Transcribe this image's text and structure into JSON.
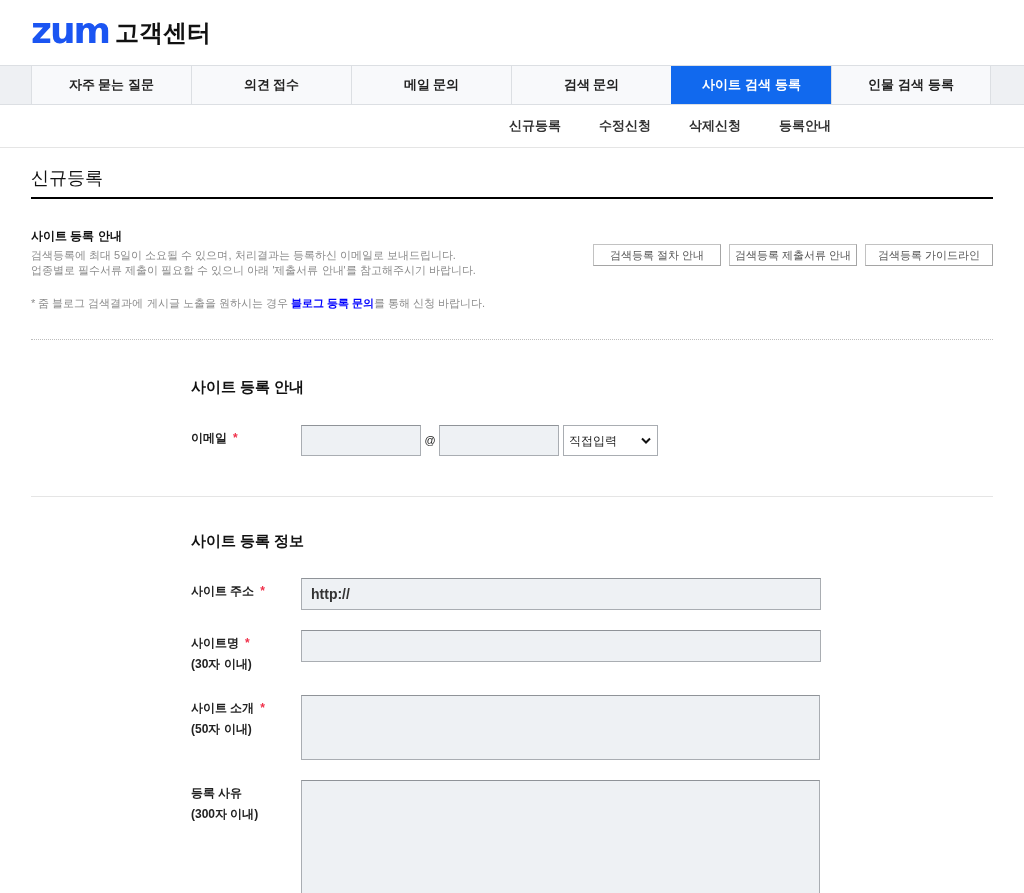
{
  "header": {
    "logo": "zum",
    "title": "고객센터"
  },
  "tabs": [
    {
      "label": "자주 묻는 질문",
      "selected": false
    },
    {
      "label": "의견 접수",
      "selected": false
    },
    {
      "label": "메일 문의",
      "selected": false
    },
    {
      "label": "검색 문의",
      "selected": false
    },
    {
      "label": "사이트 검색 등록",
      "selected": true
    },
    {
      "label": "인물 검색 등록",
      "selected": false
    }
  ],
  "subnav": [
    {
      "label": "신규등록"
    },
    {
      "label": "수정신청"
    },
    {
      "label": "삭제신청"
    },
    {
      "label": "등록안내"
    }
  ],
  "page_title": "신규등록",
  "guide": {
    "heading": "사이트 등록 안내",
    "lines": [
      "검색등록에 최대 5일이 소요될 수 있으며, 처리결과는 등록하신 이메일로 보내드립니다.",
      "업종별로 필수서류 제출이 필요할 수 있으니 아래 '제출서류 안내'를 참고해주시기 바랍니다."
    ],
    "buttons": [
      "검색등록 절차 안내",
      "검색등록 제출서류 안내",
      "검색등록 가이드라인"
    ],
    "notice": {
      "before": "* 줌 블로그 검색결과에 게시글 노출을 원하시는 경우 ",
      "link": "블로그 등록 문의",
      "after": "를 통해 신청 바랍니다."
    }
  },
  "sections": [
    {
      "heading": "사이트 등록 안내",
      "fields": [
        {
          "kind": "email",
          "label": "이메일",
          "mark": "*",
          "separator": "@",
          "select": "직접입력"
        }
      ]
    },
    {
      "heading": "사이트 등록 정보",
      "fields": [
        {
          "kind": "text",
          "label": "사이트 주소",
          "mark": "*",
          "value": "http://"
        },
        {
          "kind": "text",
          "label": "사이트명",
          "mark": "*",
          "hint": "(30자 이내)"
        },
        {
          "kind": "textarea",
          "label": "사이트 소개",
          "mark": "*",
          "hint": "(50자 이내)",
          "tall": false
        },
        {
          "kind": "textarea",
          "label": "등록 사유",
          "hint": "(300자 이내)",
          "tall": true
        }
      ]
    }
  ]
}
